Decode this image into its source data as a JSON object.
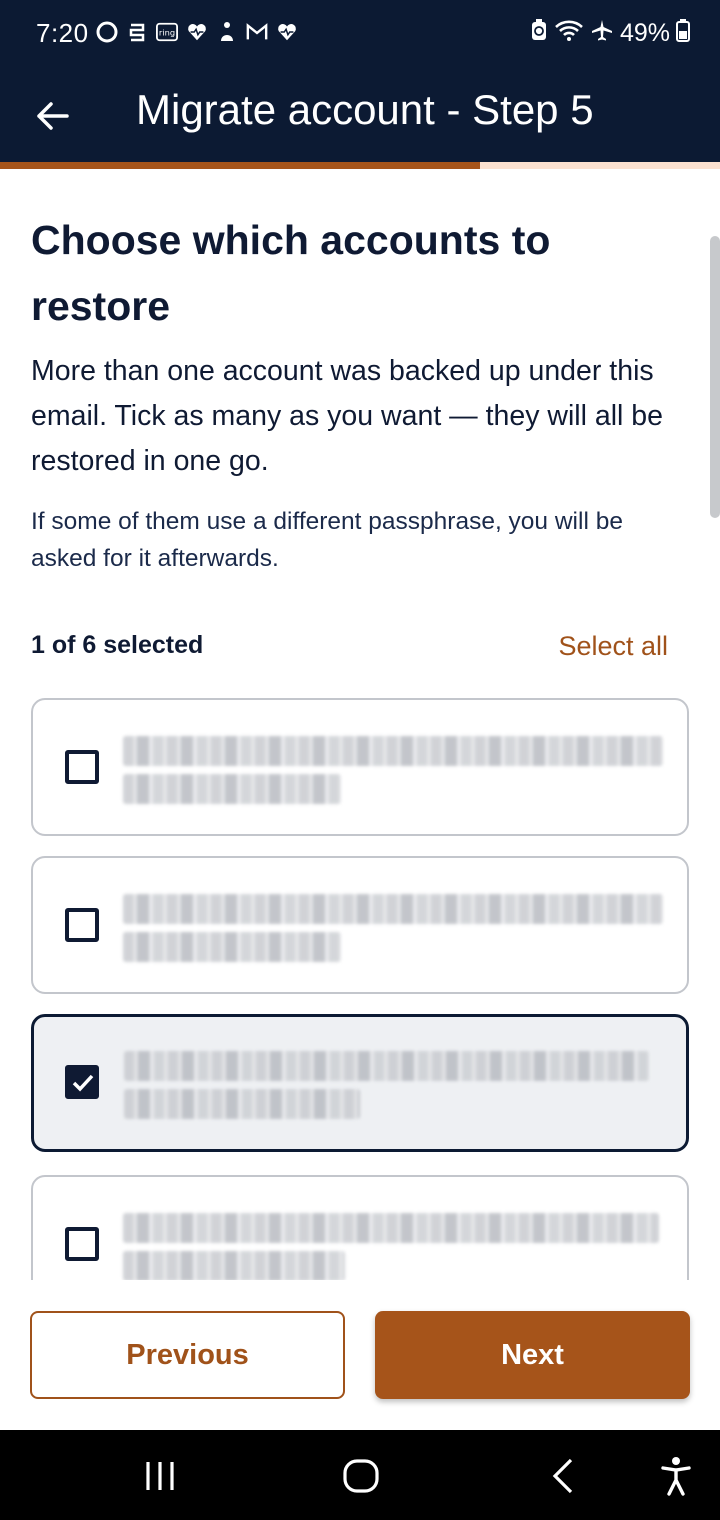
{
  "status_bar": {
    "time": "7:20",
    "battery": "49%",
    "left_icons": [
      "chat-bubble-icon",
      "s-app-icon",
      "ring-icon",
      "health-icon",
      "fitness-icon",
      "gmail-icon",
      "heartbeat-icon"
    ],
    "right_icons": [
      "battery-saver-icon",
      "wifi-icon",
      "airplane-icon",
      "battery-icon"
    ]
  },
  "app_bar": {
    "title": "Migrate account - Step 5",
    "back_icon": "arrow-back-icon"
  },
  "progress": {
    "fraction": 0.667,
    "fill_color": "#a6541a",
    "track_color": "#fbe1d0"
  },
  "main": {
    "heading": "Choose which accounts to restore",
    "intro": "More than one account was backed up under this email. Tick as many as you want — they will all be restored in one go.",
    "note": "If some of them use a different passphrase, you will be asked for it afterwards.",
    "selection_count": "1 of 6 selected",
    "select_all_label": "Select all",
    "accounts": [
      {
        "checked": false
      },
      {
        "checked": false
      },
      {
        "checked": true
      },
      {
        "checked": false
      }
    ]
  },
  "footer": {
    "previous_label": "Previous",
    "next_label": "Next"
  },
  "colors": {
    "navy": "#0c1a33",
    "accent": "#a6541a",
    "text": "#0f1a33"
  }
}
